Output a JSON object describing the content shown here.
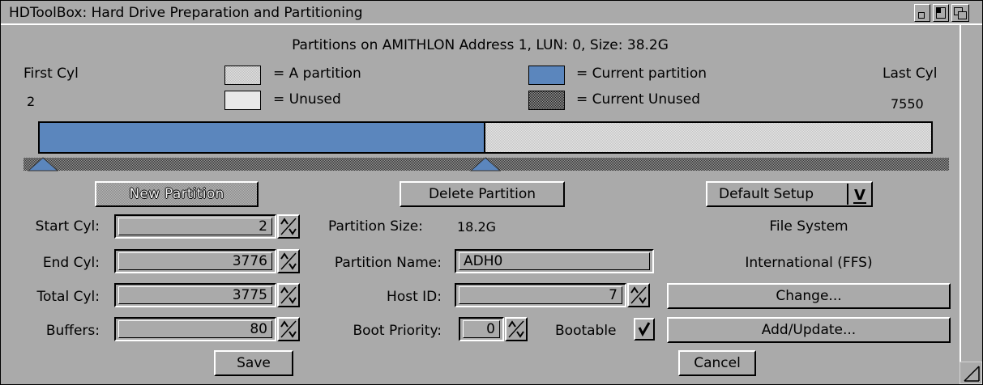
{
  "window": {
    "title": "HDToolBox: Hard Drive Preparation and Partitioning",
    "gadgets": [
      "iconify-icon",
      "zoom-icon",
      "depth-icon"
    ]
  },
  "header": {
    "info": "Partitions on AMITHLON Address 1, LUN: 0, Size: 38.2G"
  },
  "legend": {
    "first_cyl_label": "First Cyl",
    "first_cyl_value": "2",
    "last_cyl_label": "Last Cyl",
    "last_cyl_value": "7550",
    "a_partition": "= A partition",
    "unused": "= Unused",
    "current_partition": "= Current partition",
    "current_unused": "= Current Unused"
  },
  "partition_map": {
    "total_cylinders": 7550,
    "current_start": 2,
    "current_end": 3776,
    "colors": {
      "current": "#5b86bd",
      "partition": "#d8d8d8"
    }
  },
  "buttons": {
    "new_partition": "New Partition",
    "delete_partition": "Delete Partition",
    "default_setup": "Default Setup",
    "default_setup_arrow": "V",
    "save": "Save",
    "cancel": "Cancel",
    "change": "Change...",
    "add_update": "Add/Update..."
  },
  "fields": {
    "start_cyl_label": "Start Cyl:",
    "start_cyl_value": "2",
    "end_cyl_label": "End Cyl:",
    "end_cyl_value": "3776",
    "total_cyl_label": "Total Cyl:",
    "total_cyl_value": "3775",
    "buffers_label": "Buffers:",
    "buffers_value": "80",
    "partition_size_label": "Partition Size:",
    "partition_size_value": "18.2G",
    "partition_name_label": "Partition Name:",
    "partition_name_value": "ADH0",
    "host_id_label": "Host ID:",
    "host_id_value": "7",
    "boot_priority_label": "Boot Priority:",
    "boot_priority_value": "0",
    "bootable_label": "Bootable",
    "bootable_checked": true
  },
  "filesystem": {
    "label": "File System",
    "value": "International (FFS)"
  }
}
